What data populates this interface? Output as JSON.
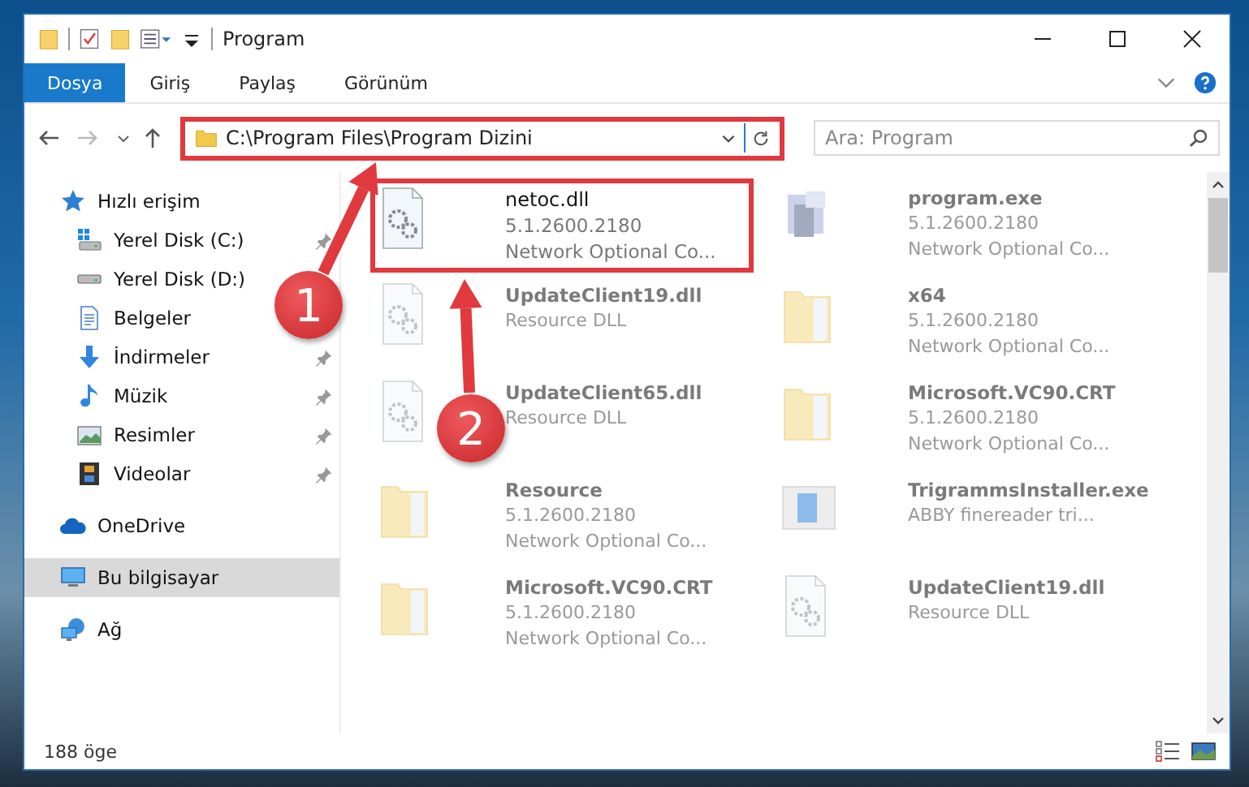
{
  "window": {
    "title": "Program"
  },
  "ribbon_tabs": [
    {
      "label": "Dosya",
      "selected": true
    },
    {
      "label": "Giriş",
      "selected": false
    },
    {
      "label": "Paylaş",
      "selected": false
    },
    {
      "label": "Görünüm",
      "selected": false
    }
  ],
  "address_bar": {
    "path": "C:\\Program Files\\Program Dizini",
    "highlighted": true
  },
  "search": {
    "placeholder": "Ara: Program"
  },
  "sidebar": {
    "items": [
      {
        "label": "Hızlı erişim",
        "kind": "star",
        "selected": false,
        "children": [
          {
            "label": "Yerel Disk (C:)",
            "kind": "drive-windows",
            "pinned": true
          },
          {
            "label": "Yerel Disk (D:)",
            "kind": "drive",
            "pinned": false
          },
          {
            "label": "Belgeler",
            "kind": "document",
            "pinned": false
          },
          {
            "label": "İndirmeler",
            "kind": "download",
            "pinned": true
          },
          {
            "label": "Müzik",
            "kind": "music",
            "pinned": true
          },
          {
            "label": "Resimler",
            "kind": "picture",
            "pinned": true
          },
          {
            "label": "Videolar",
            "kind": "film",
            "pinned": true
          }
        ]
      },
      {
        "label": "OneDrive",
        "kind": "cloud",
        "selected": false
      },
      {
        "label": "Bu bilgisayar",
        "kind": "computer",
        "selected": true
      },
      {
        "label": "Ağ",
        "kind": "network",
        "selected": false
      }
    ]
  },
  "files": [
    {
      "name": "netoc.dll",
      "lines": [
        "5.1.2600.2180",
        "Network Optional Co..."
      ],
      "kind": "dll",
      "blurred": false,
      "highlighted": true
    },
    {
      "name": "program.exe",
      "lines": [
        "5.1.2600.2180",
        "Network Optional Co..."
      ],
      "kind": "exe",
      "blurred": true,
      "highlighted": false
    },
    {
      "name": "UpdateClient19.dll",
      "lines": [
        "Resource DLL"
      ],
      "kind": "dll",
      "blurred": true,
      "highlighted": false
    },
    {
      "name": "x64",
      "lines": [
        "5.1.2600.2180",
        "Network Optional Co..."
      ],
      "kind": "folder",
      "blurred": true,
      "highlighted": false
    },
    {
      "name": "UpdateClient65.dll",
      "lines": [
        "Resource DLL"
      ],
      "kind": "dll",
      "blurred": true,
      "highlighted": false
    },
    {
      "name": "Microsoft.VC90.CRT",
      "lines": [
        "5.1.2600.2180",
        "Network Optional Co..."
      ],
      "kind": "folder",
      "blurred": true,
      "highlighted": false
    },
    {
      "name": "Resource",
      "lines": [
        "5.1.2600.2180",
        "Network Optional Co..."
      ],
      "kind": "folder",
      "blurred": true,
      "highlighted": false
    },
    {
      "name": "TrigrammsInstaller.exe",
      "lines": [
        "ABBY finereader tri..."
      ],
      "kind": "installer",
      "blurred": true,
      "highlighted": false
    },
    {
      "name": "Microsoft.VC90.CRT",
      "lines": [
        "5.1.2600.2180",
        "Network Optional Co..."
      ],
      "kind": "folder",
      "blurred": true,
      "highlighted": false
    },
    {
      "name": "UpdateClient19.dll",
      "lines": [
        "Resource DLL"
      ],
      "kind": "dll",
      "blurred": true,
      "highlighted": false
    }
  ],
  "status_bar": {
    "count": "188 öge"
  },
  "annotations": [
    {
      "label": "1"
    },
    {
      "label": "2"
    }
  ]
}
